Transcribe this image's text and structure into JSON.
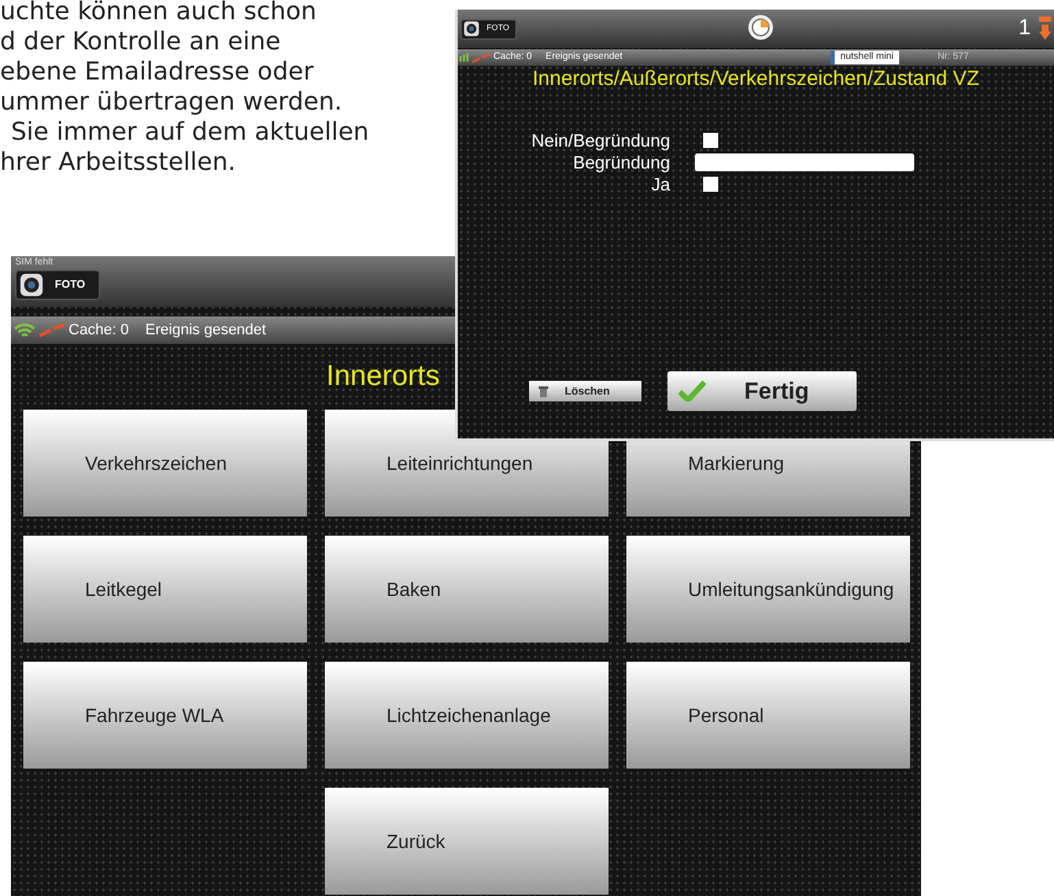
{
  "text_lines": [
    "uchte können auch schon",
    "d der Kontrolle an eine",
    "ebene Emailadresse oder",
    "ummer übertragen werden.",
    "Sie immer auf dem aktuellen",
    "hrer Arbeitsstellen."
  ],
  "back_screen": {
    "status_text": "SIM fehlt",
    "photo_button": "FOTO",
    "cache": "Cache: 0",
    "event": "Ereignis gesendet",
    "title": "Innerorts",
    "buttons": [
      {
        "label": "Verkehrszeichen"
      },
      {
        "label": "Leiteinrichtungen"
      },
      {
        "label": "Markierung"
      },
      {
        "label": "Leitkegel"
      },
      {
        "label": "Baken"
      },
      {
        "label": "Umleitungsankündigung"
      },
      {
        "label": "Fahrzeuge WLA"
      },
      {
        "label": "Lichtzeichenanlage"
      },
      {
        "label": "Personal"
      },
      {
        "label": "Zurück"
      }
    ]
  },
  "front_screen": {
    "photo_button": "FOTO",
    "counter": "1",
    "cache": "Cache: 0",
    "event": "Ereignis gesendet",
    "device_field": "nutshell mini",
    "number": "Nr: 577",
    "title": "Innerorts/Außerorts/Verkehrszeichen/Zustand VZ",
    "form": [
      {
        "kind": "checkbox",
        "label": "Nein/Begründung",
        "checked": false
      },
      {
        "kind": "text",
        "label": "Begründung"
      },
      {
        "kind": "checkbox",
        "label": "Ja",
        "checked": false
      }
    ],
    "delete_button": "Löschen",
    "done_button": "Fertig"
  }
}
